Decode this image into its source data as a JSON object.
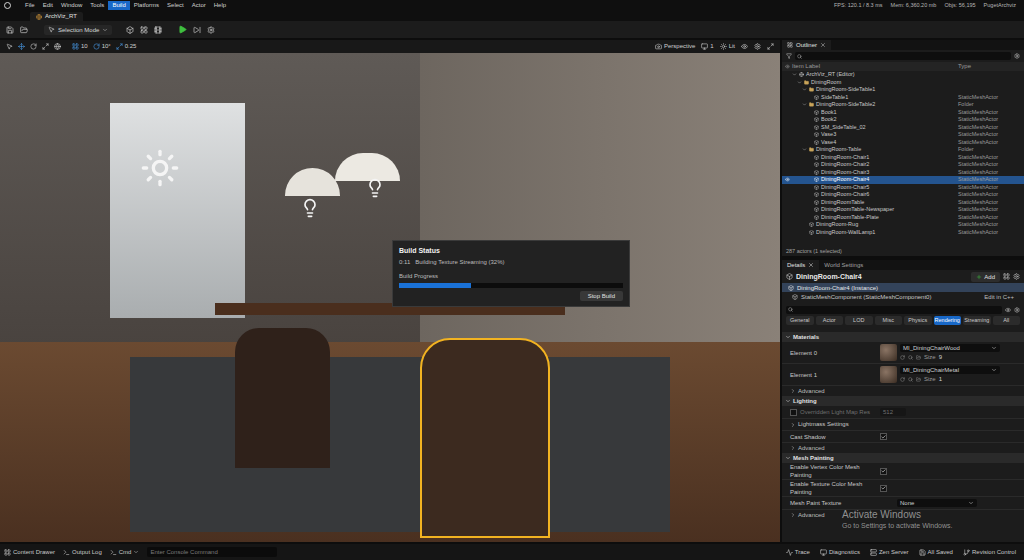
{
  "menu": [
    {
      "label": "File",
      "selected": false
    },
    {
      "label": "Edit",
      "selected": false
    },
    {
      "label": "Window",
      "selected": false
    },
    {
      "label": "Tools",
      "selected": false
    },
    {
      "label": "Build",
      "selected": true
    },
    {
      "label": "Platforms",
      "selected": false
    },
    {
      "label": "Select",
      "selected": false
    },
    {
      "label": "Actor",
      "selected": false
    },
    {
      "label": "Help",
      "selected": false
    }
  ],
  "stats": [
    "FPS: 120.1 / 8.3 ms",
    "Mem: 6,360.20 mb",
    "Objs: 56,195",
    "PugetArchviz"
  ],
  "level_tab": "ArchViz_RT",
  "toolbar": {
    "mode": "Selection Mode"
  },
  "viewport_toolbar": {
    "grid": "10",
    "rotation": "10°",
    "scale": "0.25",
    "view": "Perspective",
    "layout": "1",
    "lit": "Lit"
  },
  "build_status": {
    "title": "Build Status",
    "elapsed": "0:11",
    "message": "Building Texture Streaming (32%)",
    "progress_label": "Build Progress",
    "level": 0.32,
    "button": "Stop Build"
  },
  "outliner": {
    "title": "Outliner",
    "columns": [
      "Item Label",
      "Type"
    ],
    "rows": [
      {
        "label": "ArchViz_RT (Editor)",
        "type": "",
        "kind": "world",
        "depth": 0,
        "expanded": true,
        "selected": false
      },
      {
        "label": "DiningRoom",
        "type": "",
        "kind": "folder",
        "depth": 1,
        "expanded": true,
        "selected": false
      },
      {
        "label": "DiningRoom-SideTable1",
        "type": "",
        "kind": "folder",
        "depth": 2,
        "expanded": true,
        "selected": false
      },
      {
        "label": "SideTable1",
        "type": "StaticMeshActor",
        "kind": "actor",
        "depth": 3,
        "expanded": false,
        "selected": false
      },
      {
        "label": "DiningRoom-SideTable2",
        "type": "Folder",
        "kind": "folder",
        "depth": 2,
        "expanded": true,
        "selected": false
      },
      {
        "label": "Book1",
        "type": "StaticMeshActor",
        "kind": "actor",
        "depth": 3,
        "expanded": false,
        "selected": false
      },
      {
        "label": "Book2",
        "type": "StaticMeshActor",
        "kind": "actor",
        "depth": 3,
        "expanded": false,
        "selected": false
      },
      {
        "label": "SM_SideTable_02",
        "type": "StaticMeshActor",
        "kind": "actor",
        "depth": 3,
        "expanded": false,
        "selected": false
      },
      {
        "label": "Vase3",
        "type": "StaticMeshActor",
        "kind": "actor",
        "depth": 3,
        "expanded": false,
        "selected": false
      },
      {
        "label": "Vase4",
        "type": "StaticMeshActor",
        "kind": "actor",
        "depth": 3,
        "expanded": false,
        "selected": false
      },
      {
        "label": "DiningRoom-Table",
        "type": "Folder",
        "kind": "folder",
        "depth": 2,
        "expanded": true,
        "selected": false
      },
      {
        "label": "DiningRoom-Chair1",
        "type": "StaticMeshActor",
        "kind": "actor",
        "depth": 3,
        "expanded": false,
        "selected": false
      },
      {
        "label": "DiningRoom-Chair2",
        "type": "StaticMeshActor",
        "kind": "actor",
        "depth": 3,
        "expanded": false,
        "selected": false
      },
      {
        "label": "DiningRoom-Chair3",
        "type": "StaticMeshActor",
        "kind": "actor",
        "depth": 3,
        "expanded": false,
        "selected": false
      },
      {
        "label": "DiningRoom-Chair4",
        "type": "StaticMeshActor",
        "kind": "actor",
        "depth": 3,
        "expanded": false,
        "selected": true
      },
      {
        "label": "DiningRoom-Chair5",
        "type": "StaticMeshActor",
        "kind": "actor",
        "depth": 3,
        "expanded": false,
        "selected": false
      },
      {
        "label": "DiningRoom-Chair6",
        "type": "StaticMeshActor",
        "kind": "actor",
        "depth": 3,
        "expanded": false,
        "selected": false
      },
      {
        "label": "DiningRoomTable",
        "type": "StaticMeshActor",
        "kind": "actor",
        "depth": 3,
        "expanded": false,
        "selected": false
      },
      {
        "label": "DiningRoomTable-Newspaper",
        "type": "StaticMeshActor",
        "kind": "actor",
        "depth": 3,
        "expanded": false,
        "selected": false
      },
      {
        "label": "DiningRoomTable-Plate",
        "type": "StaticMeshActor",
        "kind": "actor",
        "depth": 3,
        "expanded": false,
        "selected": false
      },
      {
        "label": "DiningRoom-Rug",
        "type": "StaticMeshActor",
        "kind": "actor",
        "depth": 2,
        "expanded": false,
        "selected": false
      },
      {
        "label": "DiningRoom-WallLamp1",
        "type": "StaticMeshActor",
        "kind": "actor",
        "depth": 2,
        "expanded": false,
        "selected": false
      }
    ],
    "footer": "287 actors (1 selected)"
  },
  "details": {
    "tabs": [
      {
        "label": "Details",
        "selected": true
      },
      {
        "label": "World Settings",
        "selected": false
      }
    ],
    "actor": "DiningRoom-Chair4",
    "add_button": "Add",
    "components": [
      {
        "label": "DiningRoom-Chair4 (Instance)",
        "selected": true,
        "link": ""
      },
      {
        "label": "StaticMeshComponent (StaticMeshComponent0)",
        "selected": false,
        "link": "Edit in C++"
      }
    ],
    "categories": [
      {
        "label": "General",
        "selected": false
      },
      {
        "label": "Actor",
        "selected": false
      },
      {
        "label": "LOD",
        "selected": false
      },
      {
        "label": "Misc",
        "selected": false
      },
      {
        "label": "Physics",
        "selected": false
      },
      {
        "label": "Rendering",
        "selected": true
      },
      {
        "label": "Streaming",
        "selected": false
      },
      {
        "label": "All",
        "selected": false
      }
    ],
    "sections": [
      {
        "title": "Materials",
        "expanded": true,
        "rows": [
          {
            "kind": "material",
            "label": "Element 0",
            "value": "MI_DiningChairWood",
            "size_label": "Size",
            "size": "9",
            "checked": false,
            "disabled": false
          },
          {
            "kind": "material",
            "label": "Element 1",
            "value": "MI_DiningChairMetal",
            "size_label": "Size",
            "size": "1",
            "checked": false,
            "disabled": false
          },
          {
            "kind": "advanced",
            "label": "Advanced",
            "value": "",
            "checked": false,
            "disabled": false
          }
        ]
      },
      {
        "title": "Lighting",
        "expanded": true,
        "rows": [
          {
            "kind": "number",
            "label": "Overridden Light Map Res",
            "value": "512",
            "checked": false,
            "disabled": true
          },
          {
            "kind": "group",
            "label": "Lightmass Settings",
            "value": "",
            "checked": false,
            "disabled": false
          },
          {
            "kind": "checkbox",
            "label": "Cast Shadow",
            "value": "",
            "checked": true,
            "disabled": false
          },
          {
            "kind": "advanced",
            "label": "Advanced",
            "value": "",
            "checked": false,
            "disabled": false
          }
        ]
      },
      {
        "title": "Mesh Painting",
        "expanded": true,
        "rows": [
          {
            "kind": "checkbox",
            "label": "Enable Vertex Color Mesh Painting",
            "value": "",
            "checked": true,
            "disabled": false
          },
          {
            "kind": "checkbox",
            "label": "Enable Texture Color Mesh Painting",
            "value": "",
            "checked": true,
            "disabled": false
          },
          {
            "kind": "dropdown",
            "label": "Mesh Paint Texture",
            "value": "None",
            "checked": false,
            "disabled": false
          },
          {
            "kind": "advanced",
            "label": "Advanced",
            "value": "",
            "checked": false,
            "disabled": false
          }
        ]
      }
    ]
  },
  "watermark": {
    "title": "Activate Windows",
    "subtitle": "Go to Settings to activate Windows."
  },
  "status_bar": {
    "left": [
      "Content Drawer",
      "Output Log"
    ],
    "cmd": "Cmd",
    "console_placeholder": "Enter Console Command",
    "right": [
      "Trace",
      "Diagnostics",
      "Zen Server",
      "All Saved",
      "Revision Control"
    ]
  }
}
